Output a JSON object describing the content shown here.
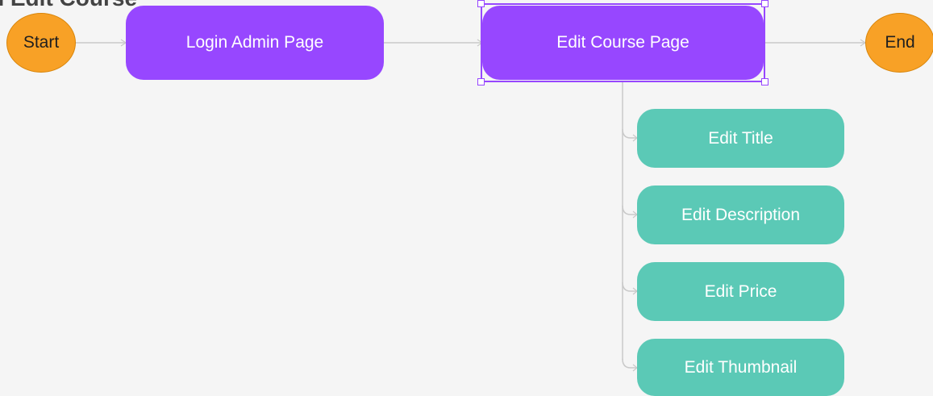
{
  "diagram": {
    "title": "n Edit Course",
    "nodes": {
      "start": "Start",
      "login": "Login Admin Page",
      "edit_course": "Edit Course Page",
      "end": "End"
    },
    "branches": [
      "Edit Title",
      "Edit Description",
      "Edit Price",
      "Edit Thumbnail"
    ]
  },
  "colors": {
    "start_end": "#f8a126",
    "process": "#9747ff",
    "sub_process": "#5bc9b6",
    "background": "#f5f5f5"
  }
}
